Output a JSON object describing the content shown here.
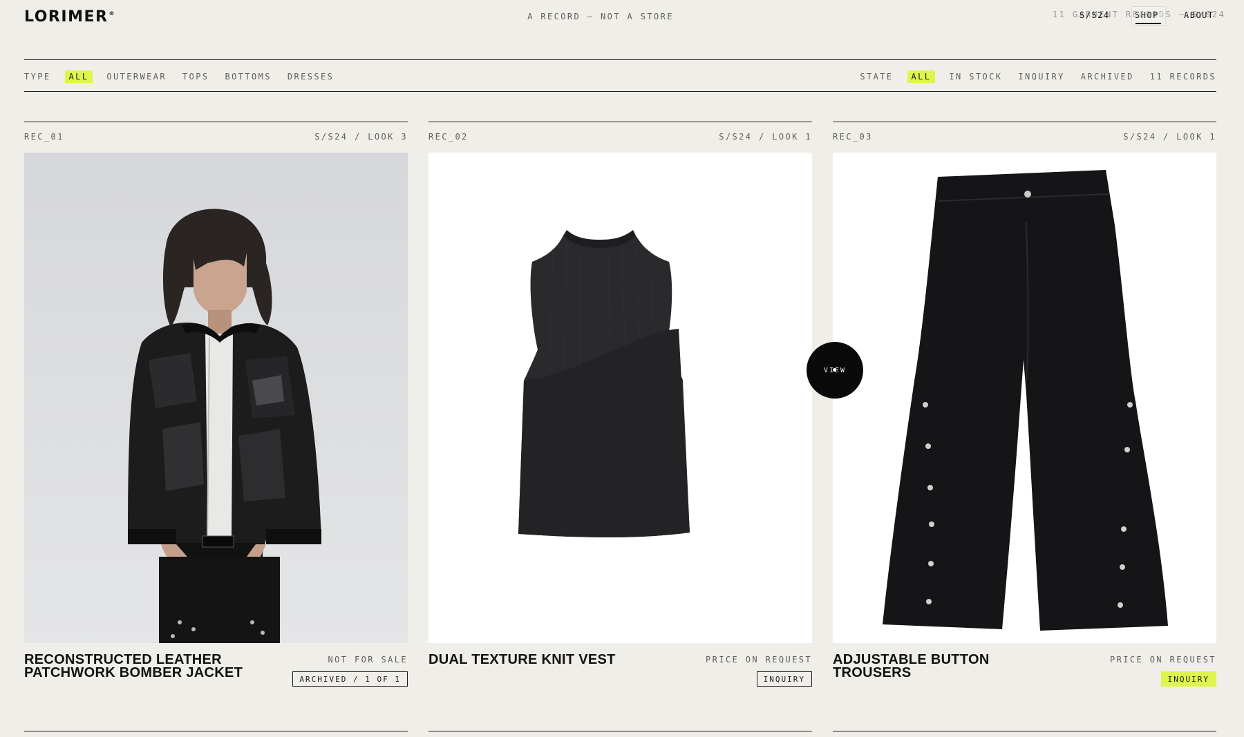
{
  "header": {
    "logo": "LORIMER",
    "logo_mark": "®",
    "tagline": "A RECORD — NOT A STORE",
    "ghost_count": "11 GARMENT RECORDS — S/S24",
    "nav": [
      {
        "label": "S/S24"
      },
      {
        "label": "SHOP"
      },
      {
        "label": "ABOUT"
      }
    ]
  },
  "filters": {
    "type_label": "TYPE",
    "type_options": [
      "ALL",
      "OUTERWEAR",
      "TOPS",
      "BOTTOMS",
      "DRESSES"
    ],
    "type_selected": "ALL",
    "state_label": "STATE",
    "state_options": [
      "ALL",
      "IN STOCK",
      "INQUIRY",
      "ARCHIVED"
    ],
    "state_selected": "ALL",
    "record_count": "11 RECORDS"
  },
  "cards": [
    {
      "id": "REC_01",
      "look": "S/S24 / LOOK 3",
      "title": "RECONSTRUCTED LEATHER PATCHWORK BOMBER JACKET",
      "price": "NOT FOR SALE",
      "badge": "ARCHIVED / 1 OF 1",
      "badge_highlight": false
    },
    {
      "id": "REC_02",
      "look": "S/S24 / LOOK 1",
      "title": "DUAL TEXTURE KNIT VEST",
      "price": "PRICE ON REQUEST",
      "badge": "INQUIRY",
      "badge_highlight": false
    },
    {
      "id": "REC_03",
      "look": "S/S24 / LOOK 1",
      "title": "ADJUSTABLE BUTTON TROUSERS",
      "price": "PRICE ON REQUEST",
      "badge": "INQUIRY",
      "badge_highlight": true
    }
  ],
  "cursor_label": "VIEW",
  "colors": {
    "background": "#f0eee9",
    "accent": "#dff44d",
    "ink": "#141414"
  }
}
